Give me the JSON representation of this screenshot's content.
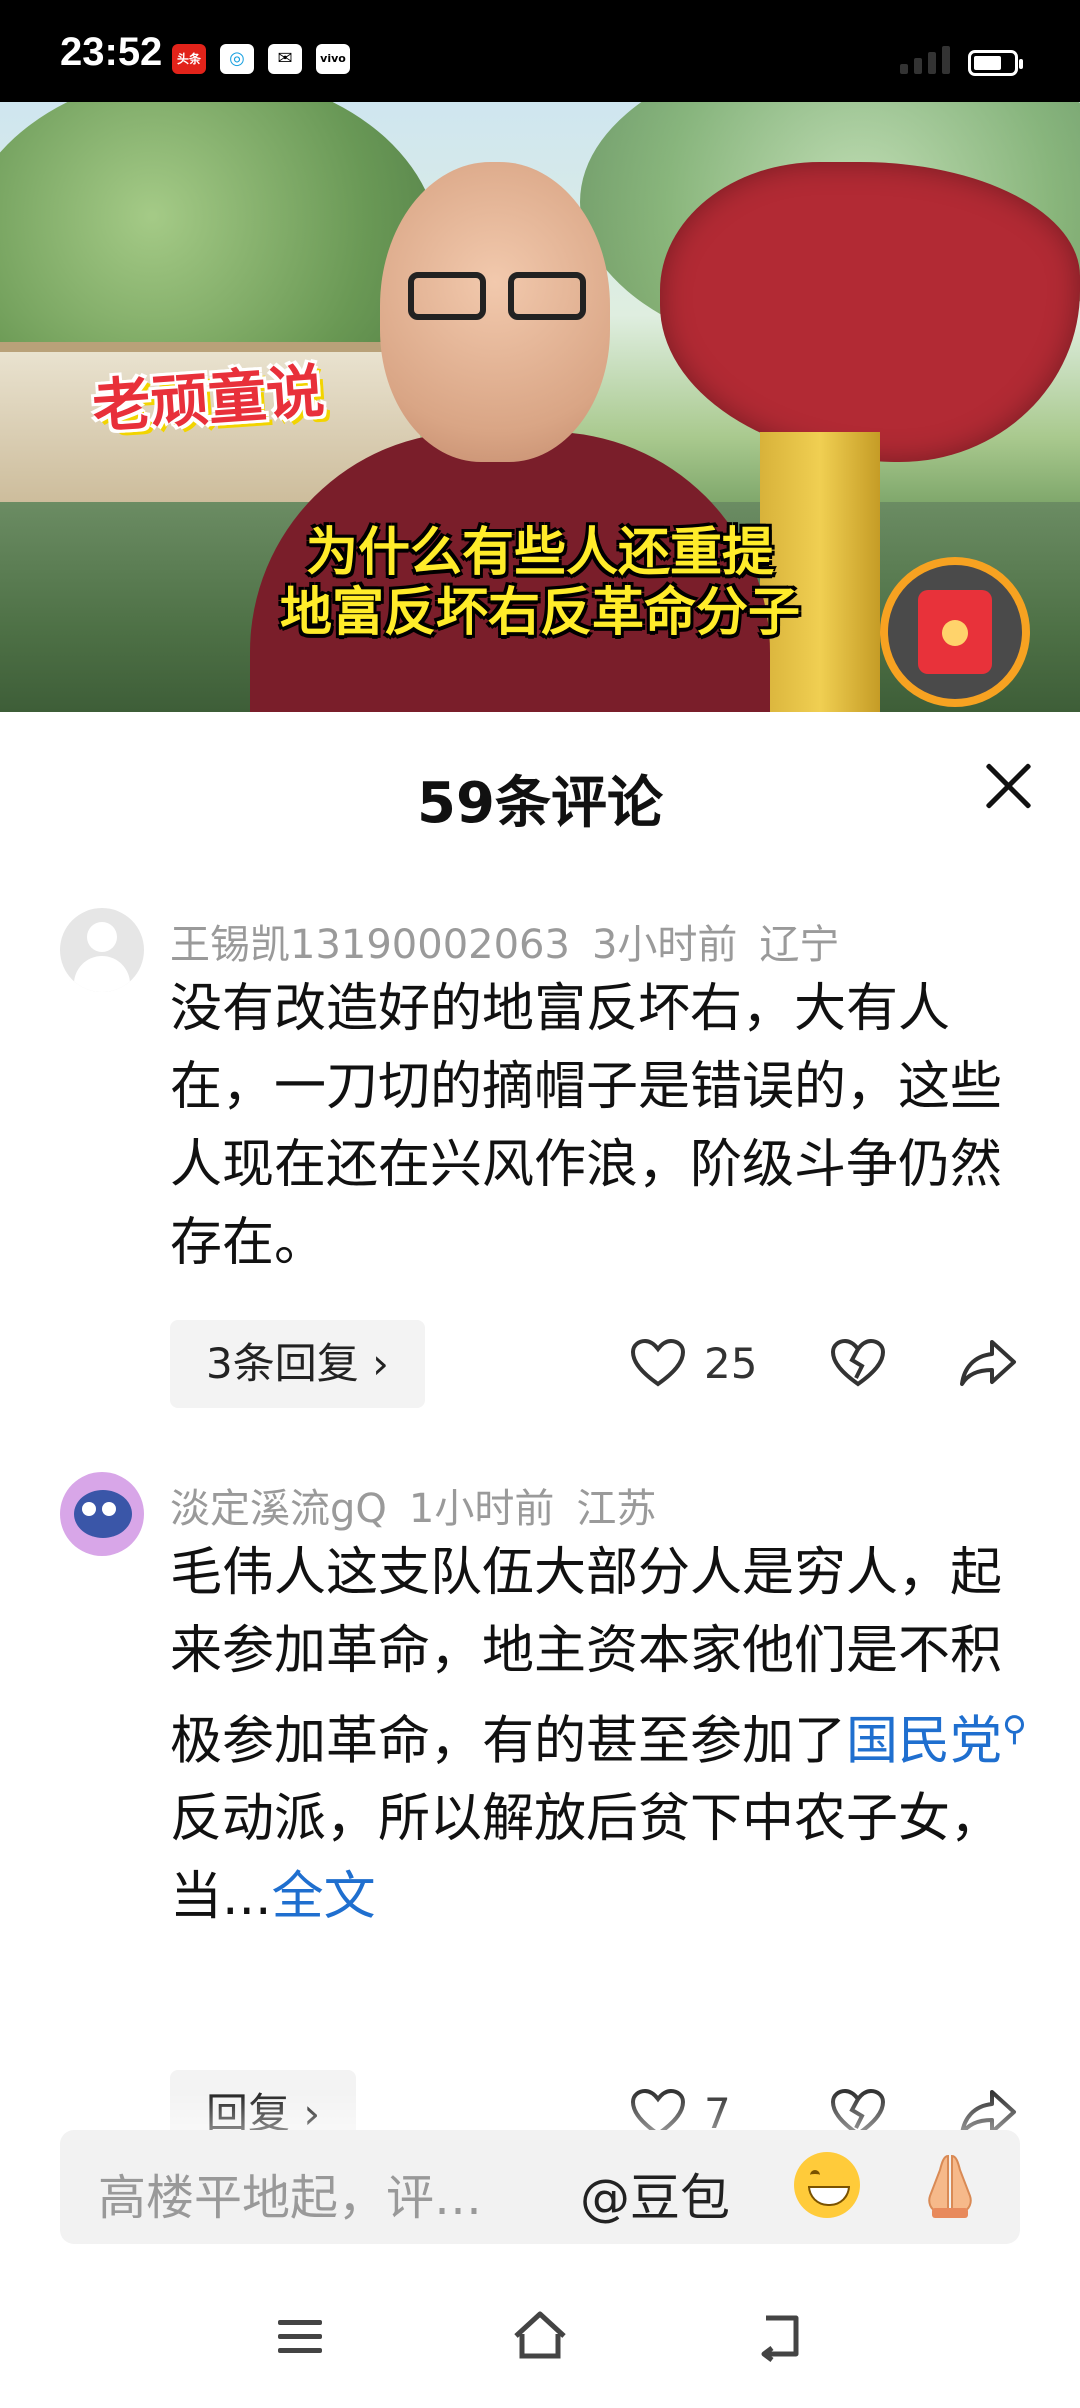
{
  "status_bar": {
    "time": "23:52",
    "notif_icons": [
      "今日头条",
      "移动",
      "消息",
      "vivo"
    ],
    "battery_level": 0.7
  },
  "video": {
    "overlay_left": "老顽童说",
    "caption_line1": "为什么有些人还重提",
    "caption_line2": "地富反坏右反革命分子",
    "red_packet_icon": "red-envelope-icon"
  },
  "sheet": {
    "title": "59条评论",
    "close_icon": "close-icon"
  },
  "comments": [
    {
      "username": "王锡凯13190002063",
      "time": "3小时前",
      "location": "辽宁",
      "text": "没有改造好的地富反坏右，大有人在，一刀切的摘帽子是错误的，这些人现在还在兴风作浪，阶级斗争仍然存在。",
      "reply_label": "3条回复 ›",
      "like_count": "25"
    },
    {
      "username": "淡定溪流gQ",
      "time": "1小时前",
      "location": "江苏",
      "text_before_link": "毛伟人这支队伍大部分人是穷人，起来参加革命，地主资本家他们是不积极参加革命，有的甚至参加了",
      "link_text": "国民党",
      "text_after_link": "反动派，所以解放后贫下中农子女，当...",
      "full_text_label": "全文",
      "reply_label": "回复 ›",
      "like_count": "7"
    }
  ],
  "input_bar": {
    "placeholder": "高楼平地起，评…",
    "at_label": "@豆包",
    "emoji1": "grinning-face-icon",
    "emoji2": "praying-hands-icon"
  },
  "nav_bar": {
    "icons": [
      "menu-icon",
      "home-icon",
      "back-icon"
    ]
  }
}
